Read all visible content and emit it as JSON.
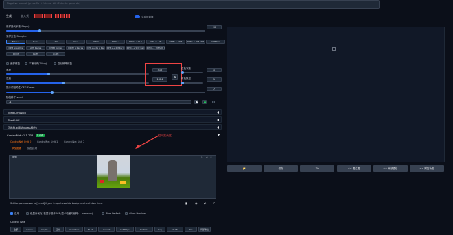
{
  "prompt": {
    "placeholder": "Negative prompt (press Ctrl+Enter or Alt+Enter to generate)"
  },
  "top_tabs": {
    "tab1": "生成",
    "tab2": "嵌入式",
    "tab3": "超网络",
    "toggle_label": "生成前替换"
  },
  "sampling_steps": {
    "label": "采样迭代步数(Steps)",
    "value": "20",
    "fraction": 0.17
  },
  "sampler": {
    "label": "采样方法(Sampler)",
    "options": [
      "Euler a",
      "Euler",
      "LMS",
      "Heun",
      "DPM2",
      "DPM2 a",
      "DPM++ 2S a",
      "DPM++ 2M",
      "DPM++ SDE",
      "DPM++ 2M SDE",
      "DPM fast",
      "DPM adaptive",
      "LMS Karras",
      "DPM2 Karras",
      "DPM2 a Karras",
      "DPM++ 2S a Karras",
      "DPM++ 2M Karras",
      "DPM++ SDE Karras",
      "DPM++ 2M SDE Karras",
      "DDIM",
      "PLMS",
      "UniPC"
    ],
    "selected": "Euler a"
  },
  "checkboxes": {
    "restore_faces": "面部修复",
    "tiling": "平铺分块(Tiling)",
    "hires": "高分辨率修复"
  },
  "width": {
    "label": "宽度",
    "value": "512",
    "fraction": 0.3
  },
  "height": {
    "label": "高度",
    "value": "1024",
    "fraction": 0.4
  },
  "batch_count": {
    "label": "总批次数",
    "value": "1"
  },
  "batch_size": {
    "label": "单批数量",
    "value": "1"
  },
  "cfg": {
    "label": "提示词相关性(CFG Scale)",
    "value": "7",
    "fraction": 0.23
  },
  "seed": {
    "label": "随机种子(seed)",
    "value": "-1"
  },
  "sections": [
    "Tiled Diffusion",
    "Tiled VAE",
    "可选附加网络(LoRA插件)",
    "ControlNet v1.1.238"
  ],
  "controlnet": {
    "badge": "1 unit",
    "units": [
      "ControlNet Unit 0",
      "ControlNet Unit 1",
      "ControlNet Unit 2"
    ],
    "subtabs": [
      "单张图像",
      "批量处理"
    ],
    "image_label": "图像",
    "hint": "Set the preprocessor to [invert] if your image has white background and black lines.",
    "enable": "启用",
    "low_vram": "低显存优化",
    "low_vram_note": "(若显存低于4GB/显卡较差时使用: --lowvram)",
    "pixel_perfect": "Pixel Perfect",
    "allow_preview": "Allow Preview",
    "control_type_label": "Control Type",
    "control_types": [
      "全部",
      "Canny",
      "Depth",
      "正常",
      "OpenPose",
      "MLSD",
      "Lineart",
      "SoftEdge",
      "Scribble",
      "Seg",
      "Shuffle",
      "Tile",
      "局部重绘"
    ]
  },
  "annotation": "相同宽高比",
  "actions": [
    "📁",
    "保存",
    "Zip",
    "<< 图生图",
    "<< 局部重绘",
    "<< 附加功能"
  ],
  "colors": {
    "accent": "#2563eb",
    "annotation": "#ef4444",
    "bg": "#0b0f19"
  }
}
